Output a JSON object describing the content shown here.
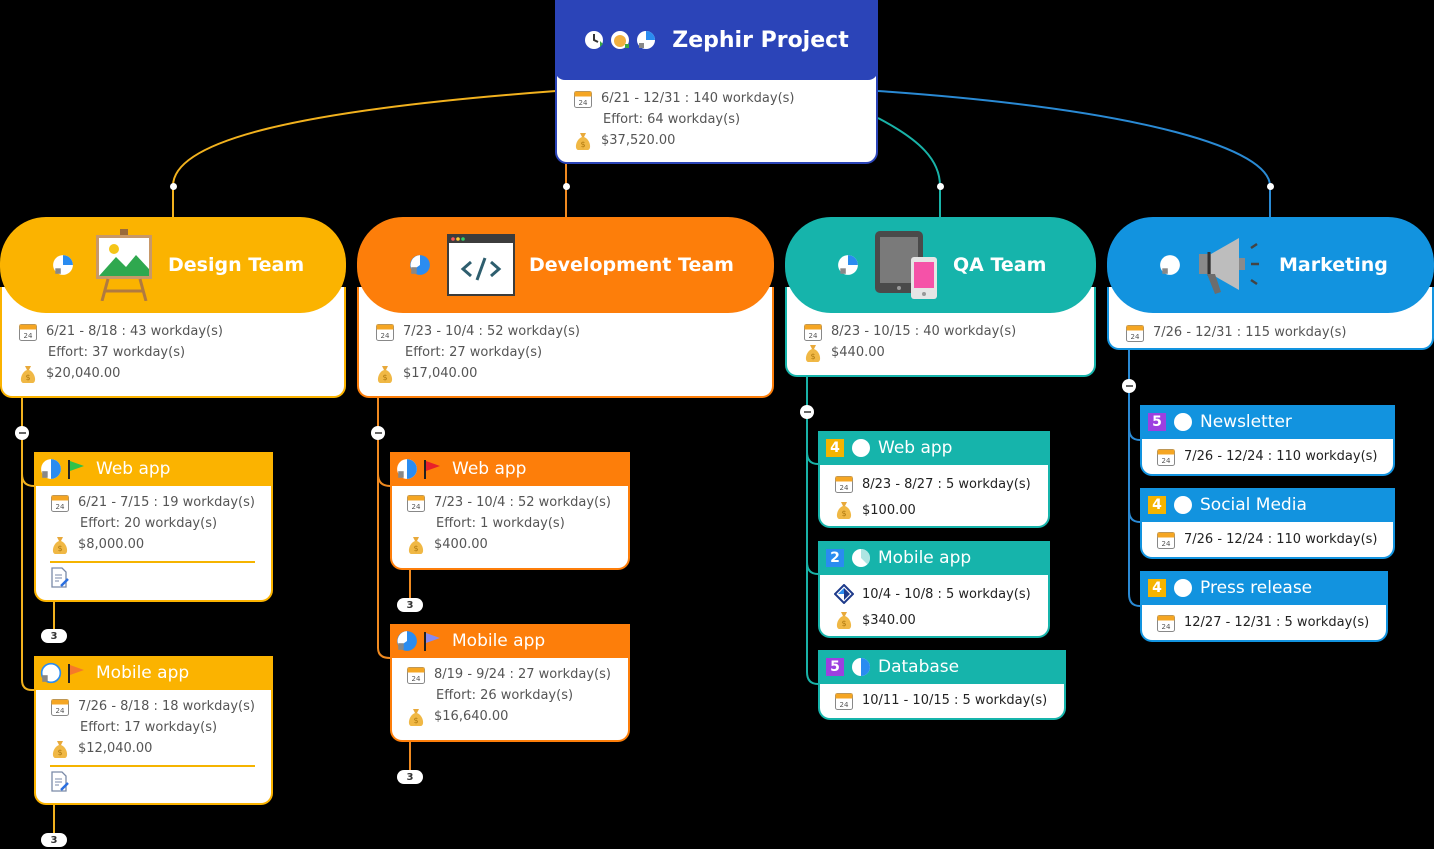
{
  "root": {
    "title": "Zephir Project",
    "icons": [
      "clock-icon",
      "money-bag-icon",
      "progress-pie-icon"
    ],
    "dates": "6/21 - 12/31 : 140 workday(s)",
    "effort": "Effort: 64 workday(s)",
    "cost": "$37,520.00",
    "color": "#2b44b8"
  },
  "teams": [
    {
      "title": "Design Team",
      "icon": "easel-picture-icon",
      "color": "#fbb300",
      "dates": "6/21 - 8/18 : 43 workday(s)",
      "effort": "Effort: 37 workday(s)",
      "cost": "$20,040.00",
      "tasks": [
        {
          "title": "Web app",
          "flag": "green-flag-icon",
          "dates": "6/21 - 7/15 : 19 workday(s)",
          "effort": "Effort: 20 workday(s)",
          "cost": "$8,000.00",
          "note": true,
          "children_count": "3"
        },
        {
          "title": "Mobile app",
          "flag": "orange-flag-icon",
          "dates": "7/26 - 8/18 : 18 workday(s)",
          "effort": "Effort: 17 workday(s)",
          "cost": "$12,040.00",
          "note": true,
          "children_count": "3"
        }
      ]
    },
    {
      "title": "Development Team",
      "icon": "code-window-icon",
      "color": "#fd7e0a",
      "dates": "7/23 - 10/4 : 52 workday(s)",
      "effort": "Effort: 27 workday(s)",
      "cost": "$17,040.00",
      "tasks": [
        {
          "title": "Web app",
          "flag": "red-flag-icon",
          "dates": "7/23 - 10/4 : 52 workday(s)",
          "effort": "Effort: 1 workday(s)",
          "cost": "$400.00",
          "children_count": "3"
        },
        {
          "title": "Mobile app",
          "flag": "purple-flag-icon",
          "dates": "8/19 - 9/24 : 27 workday(s)",
          "effort": "Effort: 26 workday(s)",
          "cost": "$16,640.00",
          "children_count": "3"
        }
      ]
    },
    {
      "title": "QA Team",
      "icon": "tablet-phone-icon",
      "color": "#16b4ab",
      "dates": "8/23 - 10/15 : 40 workday(s)",
      "cost": "$440.00",
      "tasks": [
        {
          "title": "Web app",
          "priority": "4",
          "priority_color": "#f5b400",
          "dates": "8/23 - 8/27 : 5 workday(s)",
          "cost": "$100.00"
        },
        {
          "title": "Mobile app",
          "priority": "2",
          "priority_color": "#2a8cf0",
          "date_icon": "milestone-icon",
          "dates": "10/4 - 10/8 : 5 workday(s)",
          "cost": "$340.00"
        },
        {
          "title": "Database",
          "priority": "5",
          "priority_color": "#9c40e0",
          "dates": "10/11 - 10/15 : 5 workday(s)"
        }
      ]
    },
    {
      "title": "Marketing",
      "icon": "megaphone-icon",
      "color": "#1293df",
      "dates": "7/26 - 12/31 : 115 workday(s)",
      "tasks": [
        {
          "title": "Newsletter",
          "priority": "5",
          "priority_color": "#9c40e0",
          "dates": "7/26 - 12/24 : 110 workday(s)"
        },
        {
          "title": "Social Media",
          "priority": "4",
          "priority_color": "#f5b400",
          "dates": "7/26 - 12/24 : 110 workday(s)"
        },
        {
          "title": "Press release",
          "priority": "4",
          "priority_color": "#f5b400",
          "dates": "12/27 - 12/31 : 5 workday(s)"
        }
      ]
    }
  ]
}
